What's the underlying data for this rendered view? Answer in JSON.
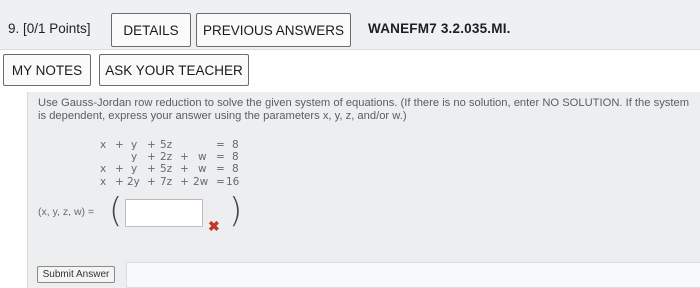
{
  "header": {
    "question_number": "9. [0/1 Points]",
    "details_label": "DETAILS",
    "previous_answers_label": "PREVIOUS ANSWERS",
    "problem_code": "WANEFM7 3.2.035.MI."
  },
  "actions": {
    "my_notes_label": "MY NOTES",
    "ask_teacher_label": "ASK YOUR TEACHER"
  },
  "question": {
    "instructions": "Use Gauss-Jordan row reduction to solve the given system of equations. (If there is no solution, enter NO SOLUTION. If the system is dependent, express your answer using the parameters x, y, z, and/or w.)",
    "equations": [
      {
        "x": "x",
        "op1": "+",
        "y": "y",
        "op2": "+",
        "z": "5z",
        "op3": "",
        "w": "",
        "eq": "=",
        "rhs": "8"
      },
      {
        "x": "",
        "op1": "",
        "y": "y",
        "op2": "+",
        "z": "2z",
        "op3": "+",
        "w": "w",
        "eq": "=",
        "rhs": "8"
      },
      {
        "x": "x",
        "op1": "+",
        "y": "y",
        "op2": "+",
        "z": "5z",
        "op3": "+",
        "w": "w",
        "eq": "=",
        "rhs": "8"
      },
      {
        "x": "x",
        "op1": "+",
        "y": "2y",
        "op2": "+",
        "z": "7z",
        "op3": "+",
        "w": "2w",
        "eq": "=",
        "rhs": "16"
      }
    ],
    "answer_label": "(x, y, z, w) =",
    "answer_value": "",
    "result_mark": "✖"
  },
  "submit_label": "Submit Answer"
}
